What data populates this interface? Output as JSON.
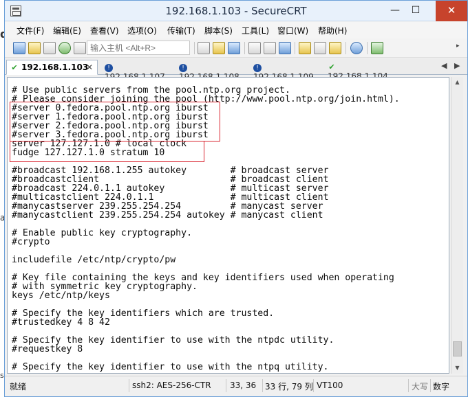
{
  "background_fragments": {
    "left_top": "d",
    "left_mid": "a",
    "left_bottom": "st"
  },
  "titlebar": {
    "app_icon": "securecrt-icon",
    "title": "192.168.1.103 - SecureCRT",
    "minimize_label": "—",
    "maximize_label": "☐",
    "close_label": "✕"
  },
  "menu": {
    "items": [
      {
        "label": "文件(F)"
      },
      {
        "label": "编辑(E)"
      },
      {
        "label": "查看(V)"
      },
      {
        "label": "选项(O)"
      },
      {
        "label": "传输(T)"
      },
      {
        "label": "脚本(S)"
      },
      {
        "label": "工具(L)"
      },
      {
        "label": "窗口(W)"
      },
      {
        "label": "帮助(H)"
      }
    ]
  },
  "toolbar": {
    "command_placeholder": "输入主机 <Alt+R>",
    "icons": [
      "connect-icon",
      "quick-connect-icon",
      "connect-in-tab-icon",
      "reconnect-icon",
      "disconnect-icon",
      "copy-icon",
      "paste-icon",
      "find-icon",
      "print-icon",
      "print-setup-icon",
      "log-session-icon",
      "session-options-icon",
      "global-options-icon",
      "keymap-icon",
      "help-icon",
      "sftp-icon"
    ]
  },
  "tabs": [
    {
      "label": "192.168.1.103",
      "status": "connected",
      "status_glyph": "✔",
      "close_label": "✕",
      "active": true
    },
    {
      "label": "192.168.1.107",
      "status": "info",
      "status_glyph": "!",
      "active": false
    },
    {
      "label": "192.168.1.108",
      "status": "info",
      "status_glyph": "!",
      "active": false
    },
    {
      "label": "192.168.1.109",
      "status": "info",
      "status_glyph": "!",
      "active": false
    },
    {
      "label": "192.168.1.104",
      "status": "connected",
      "status_glyph": "✔",
      "active": false
    }
  ],
  "tab_nav": {
    "prev": "◀",
    "next": "▶"
  },
  "terminal": {
    "lines": [
      "# Use public servers from the pool.ntp.org project.",
      "# Please consider joining the pool (http://www.pool.ntp.org/join.html).",
      "#server 0.fedora.pool.ntp.org iburst",
      "#server 1.fedora.pool.ntp.org iburst",
      "#server 2.fedora.pool.ntp.org iburst",
      "#server 3.fedora.pool.ntp.org iburst",
      "server 127.127.1.0 # local clock",
      "fudge 127.127.1.0 stratum 10",
      "",
      "#broadcast 192.168.1.255 autokey        # broadcast server",
      "#broadcastclient                        # broadcast client",
      "#broadcast 224.0.1.1 autokey            # multicast server",
      "#multicastclient 224.0.1.1              # multicast client",
      "#manycastserver 239.255.254.254         # manycast server",
      "#manycastclient 239.255.254.254 autokey # manycast client",
      "",
      "# Enable public key cryptography.",
      "#crypto",
      "",
      "includefile /etc/ntp/crypto/pw",
      "",
      "# Key file containing the keys and key identifiers used when operating",
      "# with symmetric key cryptography.",
      "keys /etc/ntp/keys",
      "",
      "# Specify the key identifiers which are trusted.",
      "#trustedkey 4 8 42",
      "",
      "# Specify the key identifier to use with the ntpdc utility.",
      "#requestkey 8",
      "",
      "# Specify the key identifier to use with the ntpq utility."
    ],
    "highlight_color": "#d9232e"
  },
  "statusbar": {
    "state": "就绪",
    "encryption": "ssh2: AES-256-CTR",
    "cursor": "33,  36",
    "size": "33 行, 79 列",
    "emulation": "VT100",
    "caps": "大写",
    "num": "数字"
  }
}
